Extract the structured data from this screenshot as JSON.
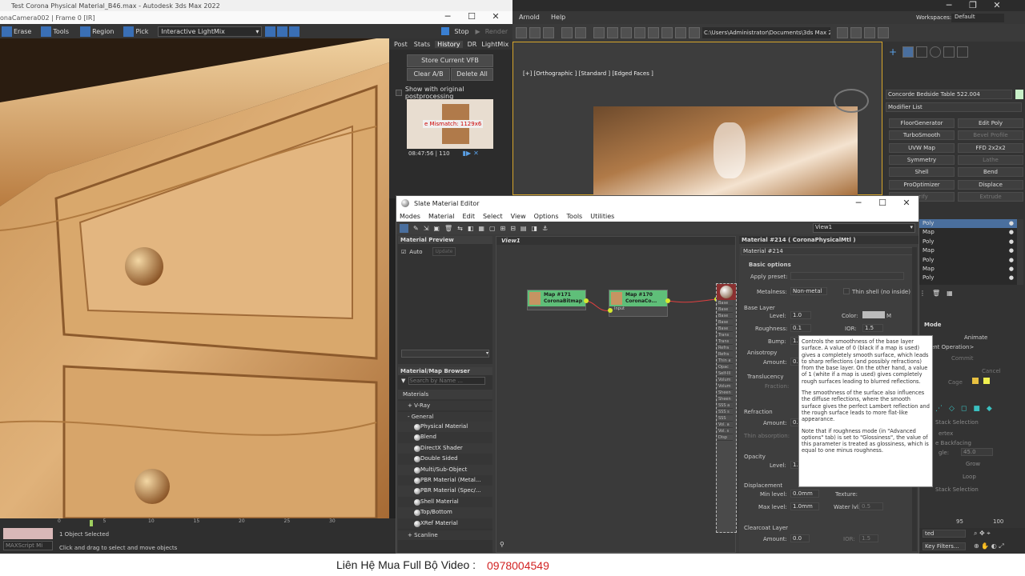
{
  "vfb": {
    "title": "Test Corona Physical Material_B46.max - Autodesk 3ds Max 2022",
    "subtitle": "onaCamera002 | Frame 0 [IR]",
    "toolbar": {
      "erase": "Erase",
      "tools": "Tools",
      "region": "Region",
      "pick": "Pick",
      "lightmix": "Interactive LightMix",
      "stop": "Stop",
      "render": "Render"
    },
    "tabs": [
      "Post",
      "Stats",
      "History",
      "DR",
      "LightMix"
    ],
    "store_btn": "Store Current VFB",
    "clear_btn": "Clear A/B",
    "delete_btn": "Delete All",
    "show_orig": "Show with original postprocessing",
    "mismatch": "e Mismatch: 1129x6",
    "thumb_time": "08:47:56 | 110"
  },
  "main_menu": {
    "arnold": "Arnold",
    "help": "Help",
    "workspaces_label": "Workspaces:",
    "workspace": "Default",
    "path": "C:\\Users\\Administrator\\Documents\\3ds Max 2022"
  },
  "viewport": {
    "label": "[+] [Orthographic ] [Standard ] [Edged Faces ]"
  },
  "cmd_panel": {
    "object_name": "Concorde Bedside Table 522.004",
    "modifier_list": "Modifier List",
    "modifiers": [
      [
        "FloorGenerator",
        "Edit Poly"
      ],
      [
        "TurboSmooth",
        "Bevel Profile"
      ],
      [
        "UVW Map",
        "FFD 2x2x2"
      ],
      [
        "Symmetry",
        "Lathe"
      ],
      [
        "Shell",
        "Bend"
      ],
      [
        "ProOptimizer",
        "Displace"
      ],
      [
        "erify",
        "Extrude"
      ]
    ],
    "stack": [
      "Poly",
      "Map",
      "Poly",
      "Map",
      "Poly",
      "Map",
      "Poly"
    ],
    "mode_label": "Mode",
    "animate": "Animate",
    "current_op": "urrent Operation>",
    "commit": "Commit",
    "cancel": "Cancel",
    "cage": "Cage",
    "stack_sel": "Stack Selection",
    "vertex": "ertex",
    "backfacing": "e Backfacing",
    "angle": "gle:",
    "angle_val": "45.0",
    "grow": "Grow",
    "loop": "Loop",
    "stack_sel2": "Stack Selection",
    "ted": "ted",
    "key_filters": "Key Filters...",
    "ruler_95": "95",
    "ruler_100": "100"
  },
  "sme": {
    "title": "Slate Material Editor",
    "menus": [
      "Modes",
      "Material",
      "Edit",
      "Select",
      "View",
      "Options",
      "Tools",
      "Utilities"
    ],
    "view_dropdown": "View1",
    "mat_preview": "Material Preview",
    "auto": "Auto",
    "update": "Update",
    "view_tab": "View1",
    "browser_title": "Material/Map Browser",
    "search_placeholder": "Search by Name ...",
    "materials_label": "Materials",
    "vray": "+ V-Ray",
    "general": "- General",
    "items": [
      "Physical Material",
      "Blend",
      "DirectX Shader",
      "Double Sided",
      "Multi/Sub-Object",
      "PBR Material (Metal...",
      "PBR Material (Spec/...",
      "Shell Material",
      "Top/Bottom",
      "XRef Material"
    ],
    "scanline": "+ Scanline",
    "nodes": [
      {
        "id": "Map #171",
        "type": "CoronaBitmap"
      },
      {
        "id": "Map #170",
        "type": "CoronaCo...",
        "port": "Input"
      }
    ],
    "main_ports": [
      "Base",
      "Base",
      "Base",
      "Base",
      "Base",
      "Trans",
      "Trans",
      "Refra",
      "Refra",
      "Thin a",
      "Opac",
      "Self-Ill",
      "Volum",
      "Volum",
      "Sheen",
      "Sheen",
      "SSS a",
      "SSS s",
      "SSS",
      "Vol. a",
      "Vol. s",
      "Disp"
    ],
    "props": {
      "header": "Material #214  ( CoronaPhysicalMtl )",
      "name": "Material #214",
      "basic": "Basic options",
      "apply_preset": "Apply preset:",
      "metalness": "Metalness:",
      "metal_val": "Non-metal",
      "thin_shell": "Thin shell (no inside)",
      "base_layer": "Base Layer",
      "level": "Level:",
      "level_val": "1.0",
      "color": "Color:",
      "roughness": "Roughness:",
      "rough_val": "0.1",
      "ior": "IOR:",
      "ior_val": "1.5",
      "bump": "Bump:",
      "bump_val": "1.",
      "anisotropy": "Anisotropy",
      "amount": "Amount:",
      "amount_val": "0.",
      "translucency": "Translucency",
      "fraction": "Fraction:",
      "refraction": "Refraction",
      "ref_amount": "Amount:",
      "ref_amount_val": "0.",
      "thin_abs": "Thin absorption:",
      "opacity": "Opacity",
      "op_level": "Level:",
      "op_level_val": "1.",
      "displacement": "Displacement",
      "min_level": "Min level:",
      "min_val": "0.0mm",
      "texture": "Texture:",
      "max_level": "Max level:",
      "max_val": "1.0mm",
      "water_lvl": "Water lvl.",
      "water_val": "0.5",
      "clearcoat": "Clearcoat Layer",
      "cc_amount": "Amount:",
      "cc_amount_val": "0.0",
      "cc_ior": "IOR:",
      "cc_ior_val": "1.5"
    },
    "tooltip": [
      "Controls the smoothness of the base layer surface. A value of 0 (black if a map is used) gives a completely smooth surface, which leads to sharp reflections (and possibly refractions) from the base layer. On the other hand, a value of 1 (white if a map is used) gives completely rough surfaces leading to blurred reflections.",
      "The smoothness of the surface also influences the diffuse reflections, where the smooth surface gives the perfect Lambert reflection and the rough surface leads to more flat-like appearance.",
      "Note that if roughness mode (in \"Advanced options\" tab) is set to \"Glossiness\", the value of this parameter is treated as glossiness, which is equal to one minus roughness."
    ]
  },
  "status": {
    "maxscript": "MAXScript Mi",
    "selected": "1 Object Selected",
    "hint": "Click and drag to select and move objects",
    "ticks": [
      "0",
      "5",
      "10",
      "15",
      "20",
      "25",
      "30"
    ]
  },
  "banner": {
    "text": "Liên Hệ Mua Full Bộ Video :",
    "phone": "0978004549"
  },
  "colors": {
    "accent": "#5aa0e6",
    "node_green": "#5fbf79",
    "banner_phone": "#d22222"
  }
}
